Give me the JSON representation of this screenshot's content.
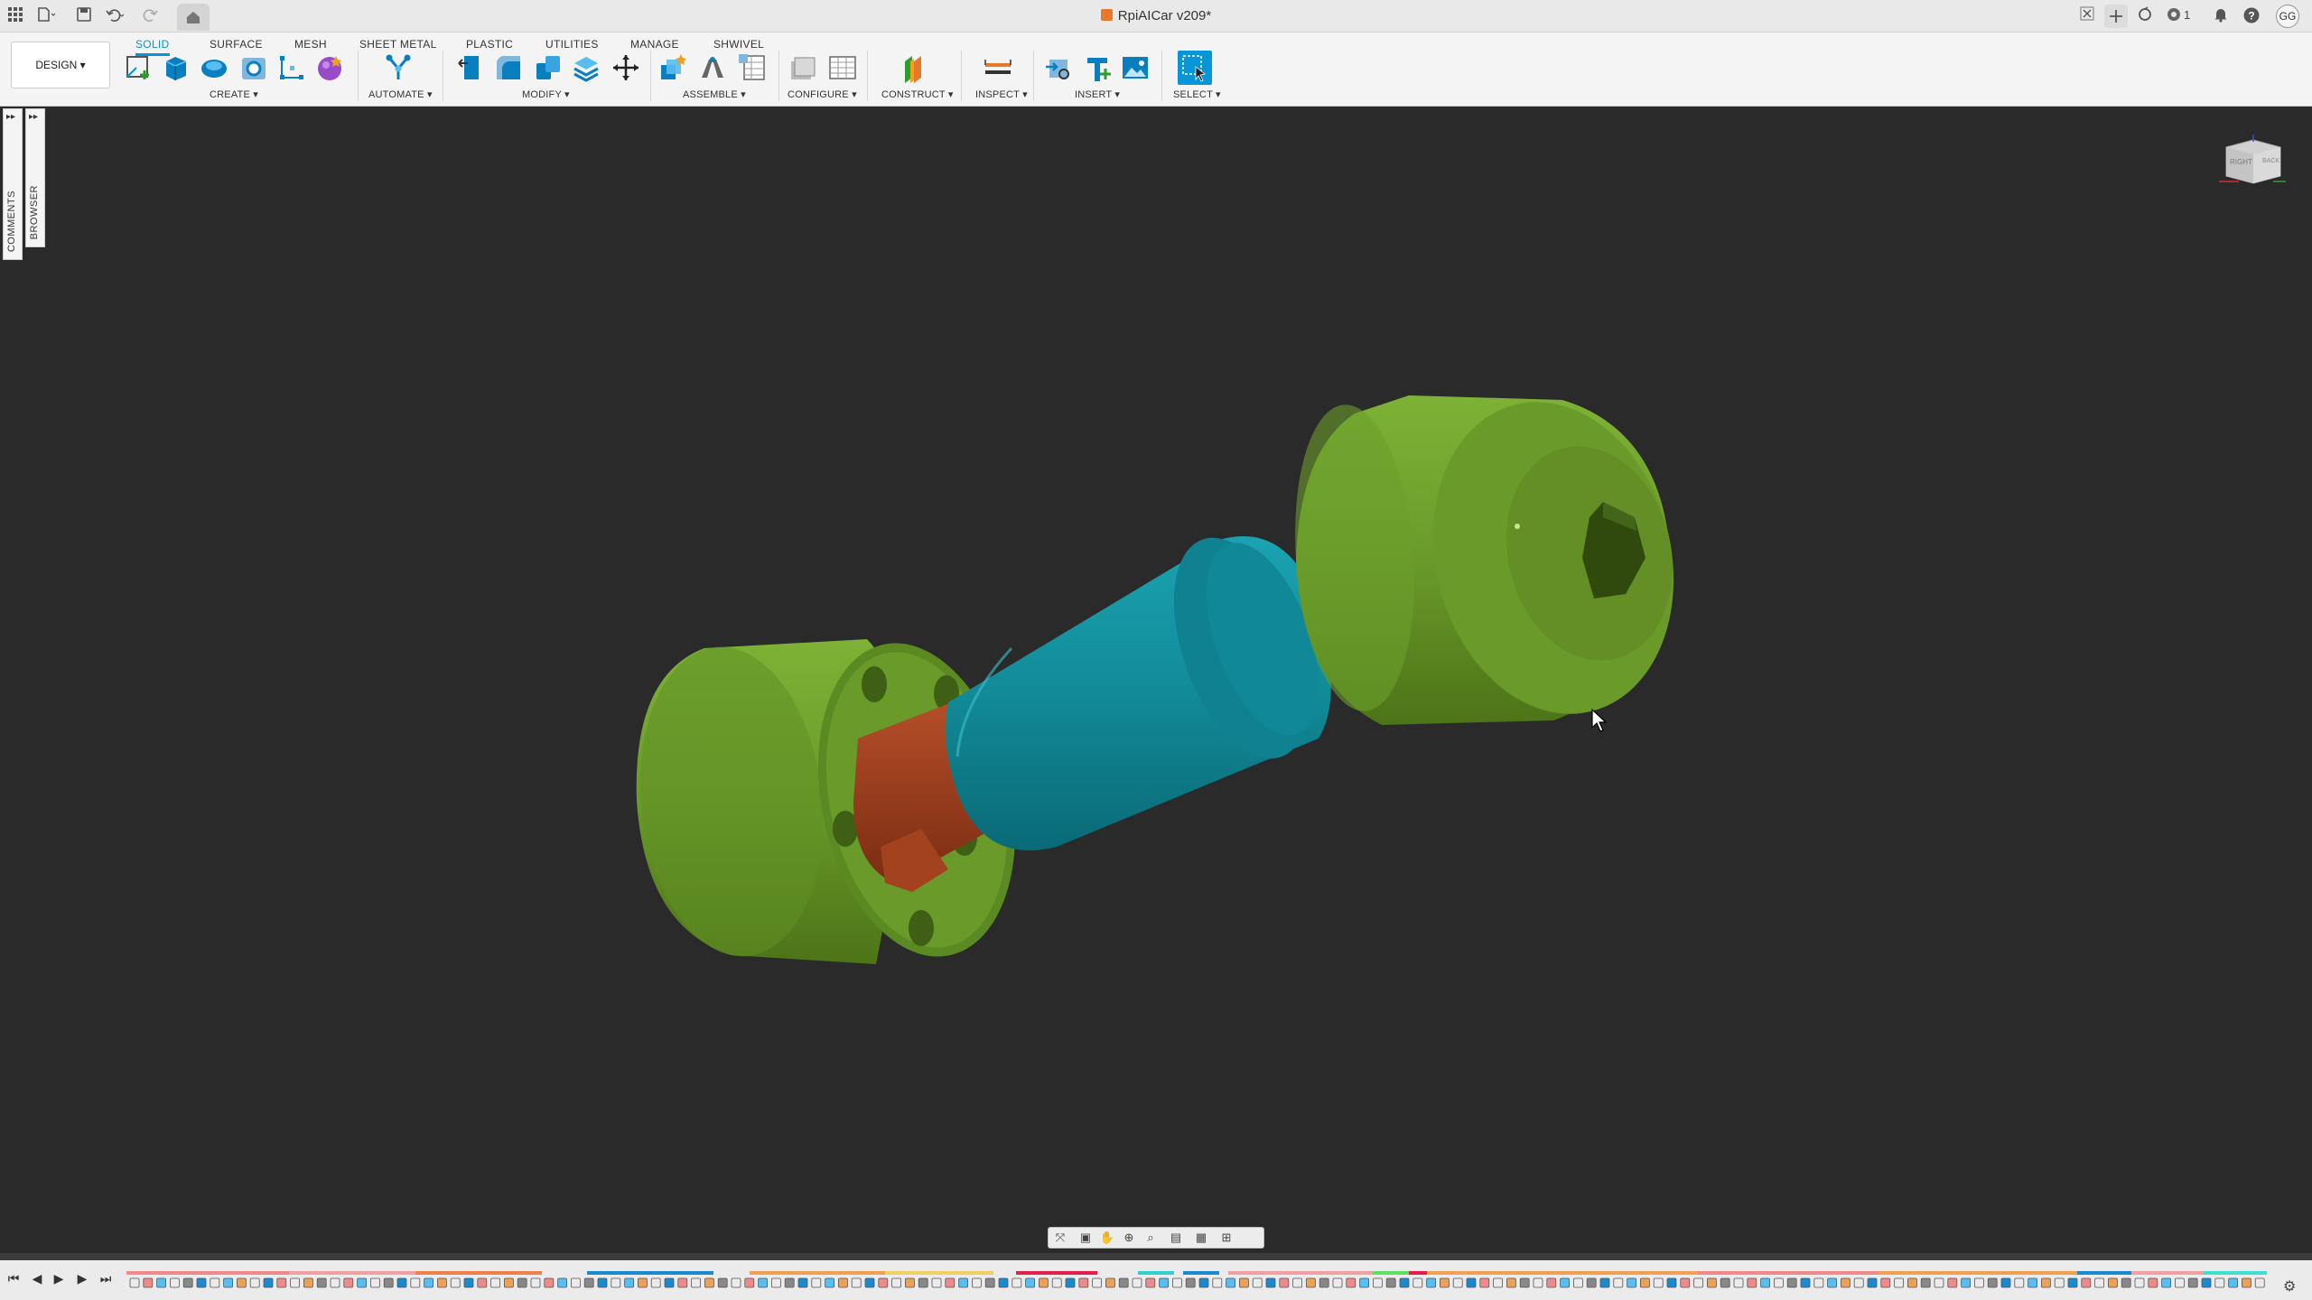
{
  "app": {
    "document_title": "RpiAICar v209*",
    "user_initials": "GG",
    "job_count": "1"
  },
  "ribbon": {
    "workspace": "DESIGN",
    "tabs": [
      {
        "label": "SOLID",
        "active": true
      },
      {
        "label": "SURFACE",
        "active": false
      },
      {
        "label": "MESH",
        "active": false
      },
      {
        "label": "SHEET METAL",
        "active": false
      },
      {
        "label": "PLASTIC",
        "active": false
      },
      {
        "label": "UTILITIES",
        "active": false
      },
      {
        "label": "MANAGE",
        "active": false
      },
      {
        "label": "SHWIVEL",
        "active": false
      }
    ],
    "groups": {
      "create": "CREATE",
      "automate": "AUTOMATE",
      "modify": "MODIFY",
      "assemble": "ASSEMBLE",
      "configure": "CONFIGURE",
      "construct": "CONSTRUCT",
      "inspect": "INSPECT",
      "insert": "INSERT",
      "select": "SELECT"
    }
  },
  "side_panels": {
    "comments": "COMMENTS",
    "browser": "BROWSER"
  },
  "viewcube": {
    "front_face": "RIGHT",
    "side_face": "BACK"
  },
  "colors": {
    "accent": "#0696d7",
    "viewport_bg": "#2a2a2a",
    "part_green": "#6a9a2a",
    "part_teal": "#128a98",
    "part_copper": "#9a3a1c"
  },
  "icons": {
    "apps": "grid-icon",
    "file": "file-icon",
    "save": "save-icon",
    "undo": "undo-icon",
    "redo": "redo-icon",
    "home": "home-icon",
    "notifications": "bell-icon",
    "help": "help-icon"
  }
}
